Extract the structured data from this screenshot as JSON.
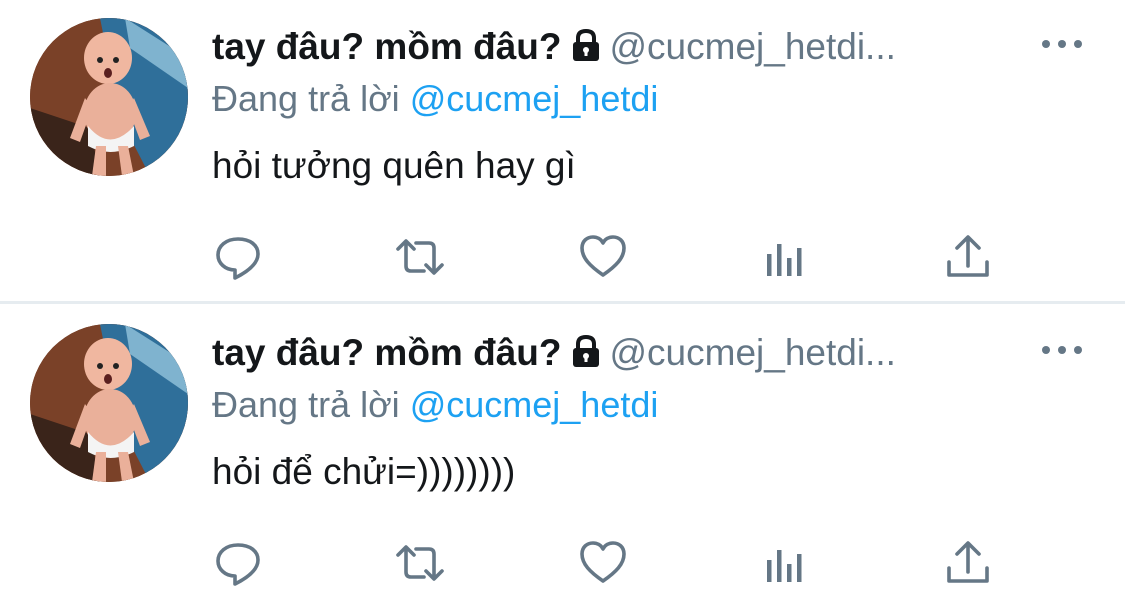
{
  "tweets": [
    {
      "display_name": "tay đâu? mồm đâu?",
      "handle": "@cucmej_hetdi...",
      "reply_prefix": "Đang trả lời",
      "reply_to": "@cucmej_hetdi",
      "text": "hỏi tưởng quên hay gì",
      "locked": true
    },
    {
      "display_name": "tay đâu? mồm đâu?",
      "handle": "@cucmej_hetdi...",
      "reply_prefix": "Đang trả lời",
      "reply_to": "@cucmej_hetdi",
      "text": "hỏi để chửi=))))))))",
      "locked": true
    }
  ],
  "icons": {
    "lock": "lock-icon",
    "more": "more-options-icon",
    "reply": "reply-icon",
    "retweet": "retweet-icon",
    "like": "like-icon",
    "analytics": "analytics-icon",
    "share": "share-icon"
  },
  "colors": {
    "text": "#14171a",
    "secondary": "#657786",
    "mention": "#1da1f2",
    "divider": "#e6ecf0"
  }
}
